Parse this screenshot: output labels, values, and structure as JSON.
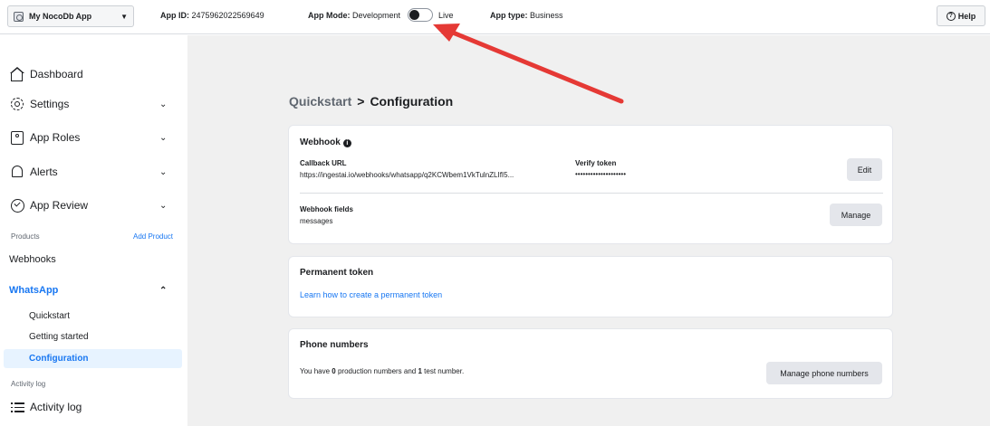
{
  "topbar": {
    "app_name": "My NocoDb App",
    "app_id_label": "App ID:",
    "app_id_value": "2475962022569649",
    "app_mode_label": "App Mode:",
    "app_mode_value": "Development",
    "live_label": "Live",
    "app_type_label": "App type:",
    "app_type_value": "Business",
    "help_label": "Help"
  },
  "sidebar": {
    "items": [
      {
        "label": "Dashboard",
        "icon": "home-icon"
      },
      {
        "label": "Settings",
        "icon": "gear-icon"
      },
      {
        "label": "App Roles",
        "icon": "roles-icon"
      },
      {
        "label": "Alerts",
        "icon": "bell-icon"
      },
      {
        "label": "App Review",
        "icon": "shield-check-icon"
      }
    ],
    "products_label": "Products",
    "add_product_label": "Add Product",
    "webhooks_label": "Webhooks",
    "whatsapp_label": "WhatsApp",
    "whatsapp_sub": [
      "Quickstart",
      "Getting started",
      "Configuration"
    ],
    "activity_section_label": "Activity log",
    "activity_log_label": "Activity log"
  },
  "main": {
    "breadcrumb": {
      "parent": "Quickstart",
      "separator": ">",
      "current": "Configuration"
    },
    "webhook_card": {
      "title": "Webhook",
      "callback_label": "Callback URL",
      "callback_value": "https://ingestai.io/webhooks/whatsapp/q2KCWbem1VkTulnZLIfI5...",
      "verify_label": "Verify token",
      "verify_value": "••••••••••••••••••••",
      "edit_label": "Edit",
      "fields_label": "Webhook fields",
      "fields_value": "messages",
      "manage_label": "Manage"
    },
    "token_card": {
      "title": "Permanent token",
      "link": "Learn how to create a permanent token"
    },
    "phone_card": {
      "title": "Phone numbers",
      "text_a": "You have ",
      "prod_count": "0",
      "text_b": " production numbers and ",
      "test_count": "1",
      "text_c": " test number.",
      "manage_label": "Manage phone numbers"
    }
  },
  "colors": {
    "accent": "#1877f2",
    "active_bg": "#e7f3ff",
    "annotation_arrow": "#e53935"
  }
}
